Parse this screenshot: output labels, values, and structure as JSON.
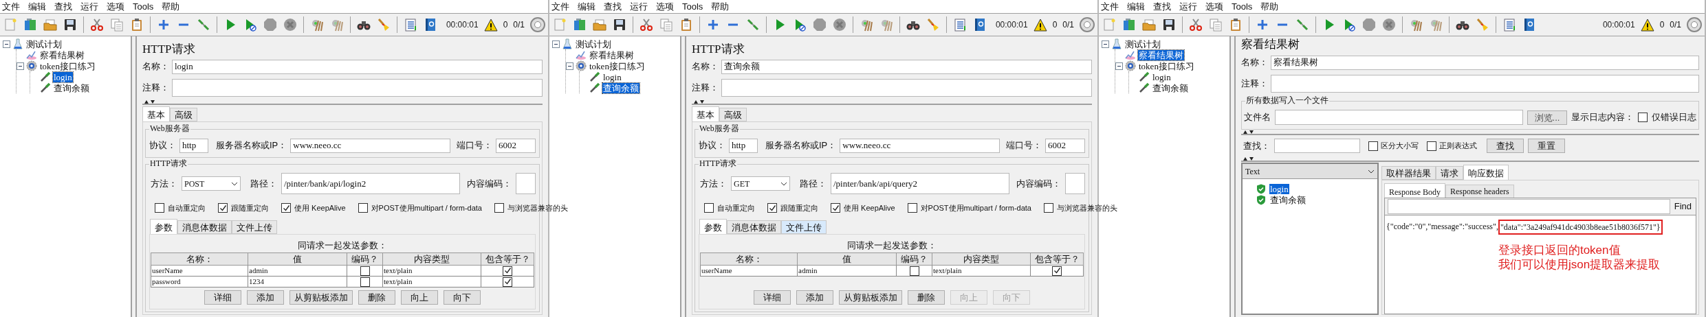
{
  "windows": [
    {
      "menu": [
        "文件",
        "编辑",
        "查找",
        "运行",
        "选项",
        "Tools",
        "帮助"
      ],
      "status": {
        "timer": "00:00:01",
        "warnings": "0",
        "threads": "0/1"
      },
      "tree": [
        {
          "label": "测试计划",
          "kind": "plan",
          "selected": false,
          "expanded": true,
          "children": [
            {
              "label": "察看结果树",
              "kind": "listener",
              "selected": false
            },
            {
              "label": "token接口练习",
              "kind": "thread_group",
              "selected": false,
              "expanded": true,
              "children": [
                {
                  "label": "login",
                  "kind": "sampler",
                  "selected": true
                },
                {
                  "label": "查询余额",
                  "kind": "sampler",
                  "selected": false
                }
              ]
            }
          ]
        }
      ],
      "panel": {
        "kind": "http_request",
        "title": "HTTP请求",
        "name_label": "名称：",
        "name": "login",
        "comment_label": "注释：",
        "tabs": [
          {
            "label": "基本",
            "selected": true
          },
          {
            "label": "高级",
            "selected": false
          }
        ],
        "server_group": {
          "legend": "Web服务器",
          "protocol_label": "协议：",
          "protocol": "http",
          "server_label": "服务器名称或IP：",
          "server": "www.neeo.cc",
          "port_label": "端口号：",
          "port": "6002"
        },
        "request_group": {
          "legend": "HTTP请求",
          "method_label": "方法：",
          "method": "POST",
          "path_label": "路径：",
          "path": "/pinter/bank/api/login2",
          "encoding_label": "内容编码："
        },
        "options": [
          {
            "label": "自动重定向",
            "checked": false
          },
          {
            "label": "跟随重定向",
            "checked": true
          },
          {
            "label": "使用 KeepAlive",
            "checked": true
          },
          {
            "label": "对POST使用multipart / form-data",
            "checked": false
          },
          {
            "label": "与浏览器兼容的头",
            "checked": false
          }
        ],
        "param_tabs": [
          {
            "label": "参数",
            "selected": true,
            "hovered": false
          },
          {
            "label": "消息体数据",
            "selected": false,
            "hovered": false
          },
          {
            "label": "文件上传",
            "selected": false,
            "hovered": false
          }
        ],
        "params_caption": "同请求一起发送参数：",
        "columns": [
          "名称：",
          "值",
          "编码？",
          "内容类型",
          "包含等于？"
        ],
        "rows": [
          {
            "name": "userName",
            "value": "admin",
            "encode": false,
            "content_type": "text/plain",
            "include_equals": true
          },
          {
            "name": "password",
            "value": "1234",
            "encode": false,
            "content_type": "text/plain",
            "include_equals": true
          }
        ],
        "buttons": [
          {
            "label": "详细",
            "disabled": false
          },
          {
            "label": "添加",
            "disabled": false
          },
          {
            "label": "从剪贴板添加",
            "disabled": false
          },
          {
            "label": "删除",
            "disabled": false
          },
          {
            "label": "向上",
            "disabled": false
          },
          {
            "label": "向下",
            "disabled": false
          }
        ]
      }
    },
    {
      "menu": [
        "文件",
        "编辑",
        "查找",
        "运行",
        "选项",
        "Tools",
        "帮助"
      ],
      "status": {
        "timer": "00:00:01",
        "warnings": "0",
        "threads": "0/1"
      },
      "tree": [
        {
          "label": "测试计划",
          "kind": "plan",
          "selected": false,
          "expanded": true,
          "children": [
            {
              "label": "察看结果树",
              "kind": "listener",
              "selected": false
            },
            {
              "label": "token接口练习",
              "kind": "thread_group",
              "selected": false,
              "expanded": true,
              "children": [
                {
                  "label": "login",
                  "kind": "sampler",
                  "selected": false
                },
                {
                  "label": "查询余额",
                  "kind": "sampler",
                  "selected": true
                }
              ]
            }
          ]
        }
      ],
      "panel": {
        "kind": "http_request",
        "title": "HTTP请求",
        "name_label": "名称：",
        "name": "查询余额",
        "comment_label": "注释：",
        "tabs": [
          {
            "label": "基本",
            "selected": true
          },
          {
            "label": "高级",
            "selected": false
          }
        ],
        "server_group": {
          "legend": "Web服务器",
          "protocol_label": "协议：",
          "protocol": "http",
          "server_label": "服务器名称或IP：",
          "server": "www.neeo.cc",
          "port_label": "端口号：",
          "port": "6002"
        },
        "request_group": {
          "legend": "HTTP请求",
          "method_label": "方法：",
          "method": "GET",
          "path_label": "路径：",
          "path": "/pinter/bank/api/query2",
          "encoding_label": "内容编码："
        },
        "options": [
          {
            "label": "自动重定向",
            "checked": false
          },
          {
            "label": "跟随重定向",
            "checked": true
          },
          {
            "label": "使用 KeepAlive",
            "checked": true
          },
          {
            "label": "对POST使用multipart / form-data",
            "checked": false
          },
          {
            "label": "与浏览器兼容的头",
            "checked": false
          }
        ],
        "param_tabs": [
          {
            "label": "参数",
            "selected": true,
            "hovered": false
          },
          {
            "label": "消息体数据",
            "selected": false,
            "hovered": false
          },
          {
            "label": "文件上传",
            "selected": false,
            "hovered": true
          }
        ],
        "params_caption": "同请求一起发送参数：",
        "columns": [
          "名称：",
          "值",
          "编码？",
          "内容类型",
          "包含等于？"
        ],
        "rows": [
          {
            "name": "userName",
            "value": "admin",
            "encode": false,
            "content_type": "text/plain",
            "include_equals": true
          }
        ],
        "buttons": [
          {
            "label": "详细",
            "disabled": false
          },
          {
            "label": "添加",
            "disabled": false
          },
          {
            "label": "从剪贴板添加",
            "disabled": false
          },
          {
            "label": "删除",
            "disabled": false
          },
          {
            "label": "向上",
            "disabled": true
          },
          {
            "label": "向下",
            "disabled": true
          }
        ]
      }
    },
    {
      "menu": [
        "文件",
        "编辑",
        "查找",
        "运行",
        "选项",
        "Tools",
        "帮助"
      ],
      "status": {
        "timer": "00:00:01",
        "warnings": "0",
        "threads": "0/1"
      },
      "tree": [
        {
          "label": "测试计划",
          "kind": "plan",
          "selected": false,
          "expanded": true,
          "children": [
            {
              "label": "察看结果树",
              "kind": "listener",
              "selected": true
            },
            {
              "label": "token接口练习",
              "kind": "thread_group",
              "selected": false,
              "expanded": true,
              "children": [
                {
                  "label": "login",
                  "kind": "sampler",
                  "selected": false
                },
                {
                  "label": "查询余额",
                  "kind": "sampler",
                  "selected": false
                }
              ]
            }
          ]
        }
      ],
      "panel": {
        "kind": "results_tree",
        "title": "察看结果树",
        "name_label": "名称：",
        "name": "察看结果树",
        "comment_label": "注释：",
        "file_group": {
          "legend": "所有数据写入一个文件",
          "file_label": "文件名",
          "browse_button": "浏览...",
          "log_label": "显示日志内容：",
          "errors_only": {
            "label": "仅错误日志",
            "checked": false
          }
        },
        "search": {
          "label": "查找：",
          "options": [
            {
              "label": "区分大小写",
              "checked": false
            },
            {
              "label": "正则表达式",
              "checked": false
            }
          ],
          "buttons": [
            "查找",
            "重置"
          ]
        },
        "renderer": "Text",
        "results": [
          {
            "label": "login",
            "success": true,
            "selected": true
          },
          {
            "label": "查询余额",
            "success": true,
            "selected": false
          }
        ],
        "result_tabs": [
          {
            "label": "取样器结果",
            "selected": false
          },
          {
            "label": "请求",
            "selected": false
          },
          {
            "label": "响应数据",
            "selected": true
          }
        ],
        "body_tabs": [
          {
            "label": "Response Body",
            "selected": true
          },
          {
            "label": "Response headers",
            "selected": false
          }
        ],
        "find_button": "Find",
        "response_text": "{\"code\":\"0\",\"message\":\"success\",",
        "highlighted_text": "\"data\":\"3a249af941dc4903b8eae51b8036f571\"}",
        "annotation": [
          "登录接口返回的token值",
          "我们可以使用json提取器来提取"
        ]
      }
    }
  ]
}
